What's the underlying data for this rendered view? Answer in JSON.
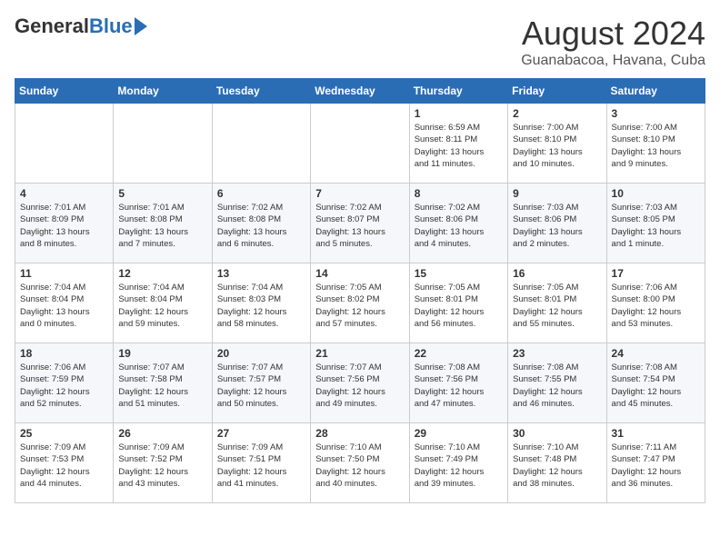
{
  "header": {
    "logo_general": "General",
    "logo_blue": "Blue",
    "month_year": "August 2024",
    "location": "Guanabacoa, Havana, Cuba"
  },
  "weekdays": [
    "Sunday",
    "Monday",
    "Tuesday",
    "Wednesday",
    "Thursday",
    "Friday",
    "Saturday"
  ],
  "weeks": [
    [
      {
        "day": "",
        "info": ""
      },
      {
        "day": "",
        "info": ""
      },
      {
        "day": "",
        "info": ""
      },
      {
        "day": "",
        "info": ""
      },
      {
        "day": "1",
        "info": "Sunrise: 6:59 AM\nSunset: 8:11 PM\nDaylight: 13 hours\nand 11 minutes."
      },
      {
        "day": "2",
        "info": "Sunrise: 7:00 AM\nSunset: 8:10 PM\nDaylight: 13 hours\nand 10 minutes."
      },
      {
        "day": "3",
        "info": "Sunrise: 7:00 AM\nSunset: 8:10 PM\nDaylight: 13 hours\nand 9 minutes."
      }
    ],
    [
      {
        "day": "4",
        "info": "Sunrise: 7:01 AM\nSunset: 8:09 PM\nDaylight: 13 hours\nand 8 minutes."
      },
      {
        "day": "5",
        "info": "Sunrise: 7:01 AM\nSunset: 8:08 PM\nDaylight: 13 hours\nand 7 minutes."
      },
      {
        "day": "6",
        "info": "Sunrise: 7:02 AM\nSunset: 8:08 PM\nDaylight: 13 hours\nand 6 minutes."
      },
      {
        "day": "7",
        "info": "Sunrise: 7:02 AM\nSunset: 8:07 PM\nDaylight: 13 hours\nand 5 minutes."
      },
      {
        "day": "8",
        "info": "Sunrise: 7:02 AM\nSunset: 8:06 PM\nDaylight: 13 hours\nand 4 minutes."
      },
      {
        "day": "9",
        "info": "Sunrise: 7:03 AM\nSunset: 8:06 PM\nDaylight: 13 hours\nand 2 minutes."
      },
      {
        "day": "10",
        "info": "Sunrise: 7:03 AM\nSunset: 8:05 PM\nDaylight: 13 hours\nand 1 minute."
      }
    ],
    [
      {
        "day": "11",
        "info": "Sunrise: 7:04 AM\nSunset: 8:04 PM\nDaylight: 13 hours\nand 0 minutes."
      },
      {
        "day": "12",
        "info": "Sunrise: 7:04 AM\nSunset: 8:04 PM\nDaylight: 12 hours\nand 59 minutes."
      },
      {
        "day": "13",
        "info": "Sunrise: 7:04 AM\nSunset: 8:03 PM\nDaylight: 12 hours\nand 58 minutes."
      },
      {
        "day": "14",
        "info": "Sunrise: 7:05 AM\nSunset: 8:02 PM\nDaylight: 12 hours\nand 57 minutes."
      },
      {
        "day": "15",
        "info": "Sunrise: 7:05 AM\nSunset: 8:01 PM\nDaylight: 12 hours\nand 56 minutes."
      },
      {
        "day": "16",
        "info": "Sunrise: 7:05 AM\nSunset: 8:01 PM\nDaylight: 12 hours\nand 55 minutes."
      },
      {
        "day": "17",
        "info": "Sunrise: 7:06 AM\nSunset: 8:00 PM\nDaylight: 12 hours\nand 53 minutes."
      }
    ],
    [
      {
        "day": "18",
        "info": "Sunrise: 7:06 AM\nSunset: 7:59 PM\nDaylight: 12 hours\nand 52 minutes."
      },
      {
        "day": "19",
        "info": "Sunrise: 7:07 AM\nSunset: 7:58 PM\nDaylight: 12 hours\nand 51 minutes."
      },
      {
        "day": "20",
        "info": "Sunrise: 7:07 AM\nSunset: 7:57 PM\nDaylight: 12 hours\nand 50 minutes."
      },
      {
        "day": "21",
        "info": "Sunrise: 7:07 AM\nSunset: 7:56 PM\nDaylight: 12 hours\nand 49 minutes."
      },
      {
        "day": "22",
        "info": "Sunrise: 7:08 AM\nSunset: 7:56 PM\nDaylight: 12 hours\nand 47 minutes."
      },
      {
        "day": "23",
        "info": "Sunrise: 7:08 AM\nSunset: 7:55 PM\nDaylight: 12 hours\nand 46 minutes."
      },
      {
        "day": "24",
        "info": "Sunrise: 7:08 AM\nSunset: 7:54 PM\nDaylight: 12 hours\nand 45 minutes."
      }
    ],
    [
      {
        "day": "25",
        "info": "Sunrise: 7:09 AM\nSunset: 7:53 PM\nDaylight: 12 hours\nand 44 minutes."
      },
      {
        "day": "26",
        "info": "Sunrise: 7:09 AM\nSunset: 7:52 PM\nDaylight: 12 hours\nand 43 minutes."
      },
      {
        "day": "27",
        "info": "Sunrise: 7:09 AM\nSunset: 7:51 PM\nDaylight: 12 hours\nand 41 minutes."
      },
      {
        "day": "28",
        "info": "Sunrise: 7:10 AM\nSunset: 7:50 PM\nDaylight: 12 hours\nand 40 minutes."
      },
      {
        "day": "29",
        "info": "Sunrise: 7:10 AM\nSunset: 7:49 PM\nDaylight: 12 hours\nand 39 minutes."
      },
      {
        "day": "30",
        "info": "Sunrise: 7:10 AM\nSunset: 7:48 PM\nDaylight: 12 hours\nand 38 minutes."
      },
      {
        "day": "31",
        "info": "Sunrise: 7:11 AM\nSunset: 7:47 PM\nDaylight: 12 hours\nand 36 minutes."
      }
    ]
  ]
}
